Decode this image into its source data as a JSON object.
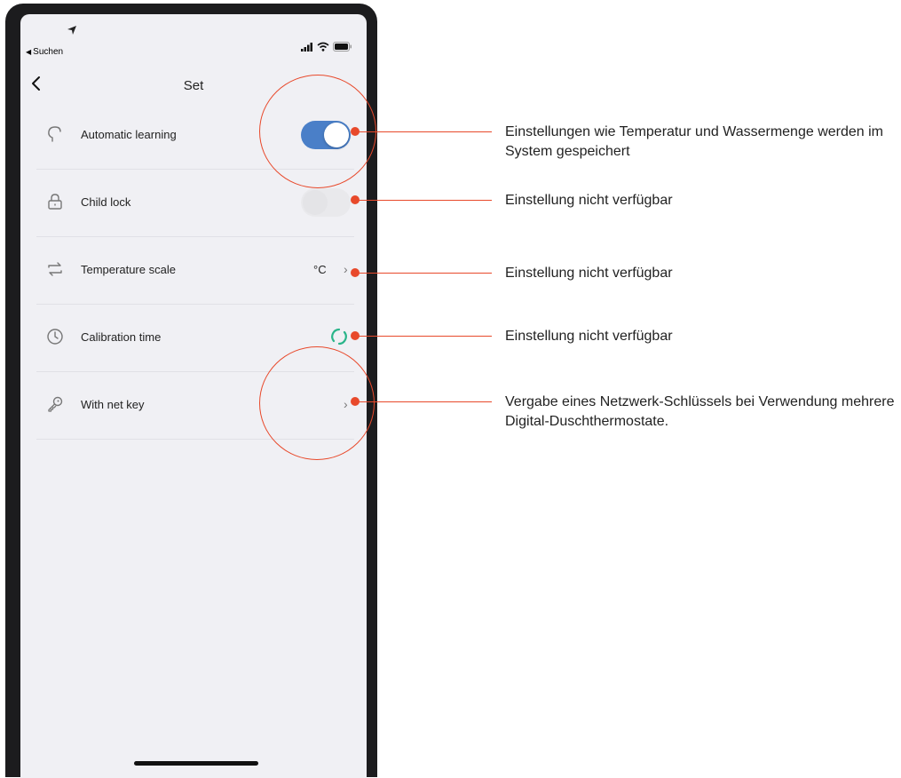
{
  "status_bar": {
    "back_app_label": "Suchen"
  },
  "nav": {
    "title": "Set"
  },
  "settings": [
    {
      "label": "Automatic learning",
      "icon": "head-icon",
      "control": "toggle",
      "state": "on"
    },
    {
      "label": "Child lock",
      "icon": "lock-icon",
      "control": "toggle",
      "state": "disabled"
    },
    {
      "label": "Temperature scale",
      "icon": "swap-icon",
      "control": "value-chevron",
      "value": "°C"
    },
    {
      "label": "Calibration time",
      "icon": "clock-icon",
      "control": "spinner"
    },
    {
      "label": "With net key",
      "icon": "key-icon",
      "control": "chevron"
    }
  ],
  "annotations": [
    {
      "text": "Einstellungen wie Temperatur und Wassermenge werden im System gespeichert"
    },
    {
      "text": "Einstellung nicht verfügbar"
    },
    {
      "text": "Einstellung nicht verfügbar"
    },
    {
      "text": "Einstellung nicht verfügbar"
    },
    {
      "text": "Vergabe eines Netzwerk-Schlüssels bei Verwendung mehrere Digital-Duschthermostate."
    }
  ],
  "colors": {
    "accent": "#4a7fc8",
    "annotation": "#e8492b",
    "spinner": "#2bb58a"
  }
}
